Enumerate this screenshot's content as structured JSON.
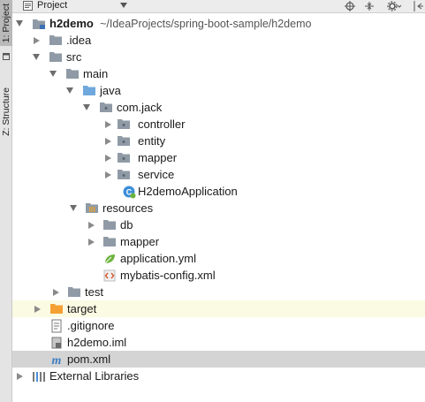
{
  "window": {
    "tool_window_title": "Project"
  },
  "side_tabs": {
    "project": "1: Project",
    "structure": "Z: Structure"
  },
  "header_icons": [
    "crosshair-icon",
    "collapse-icon",
    "settings-icon",
    "hide-icon"
  ],
  "tree": {
    "root": {
      "name": "h2demo",
      "path": "~/IdeaProjects/spring-boot-sample/h2demo"
    },
    "idea": ".idea",
    "src": "src",
    "main": "main",
    "java": "java",
    "package": "com.jack",
    "controller": "controller",
    "entity": "entity",
    "mapper": "mapper",
    "service": "service",
    "app_class": "H2demoApplication",
    "resources": "resources",
    "db": "db",
    "res_mapper": "mapper",
    "app_yml": "application.yml",
    "mybatis_xml": "mybatis-config.xml",
    "test": "test",
    "target": "target",
    "gitignore": ".gitignore",
    "iml": "h2demo.iml",
    "pom": "pom.xml",
    "external": "External Libraries"
  },
  "colors": {
    "folder": "#8f9aa6",
    "source_folder": "#6fa8dc",
    "target_folder": "#f5a033",
    "selected_row": "#d4d4d4",
    "excluded_row": "#fbfbe3"
  }
}
